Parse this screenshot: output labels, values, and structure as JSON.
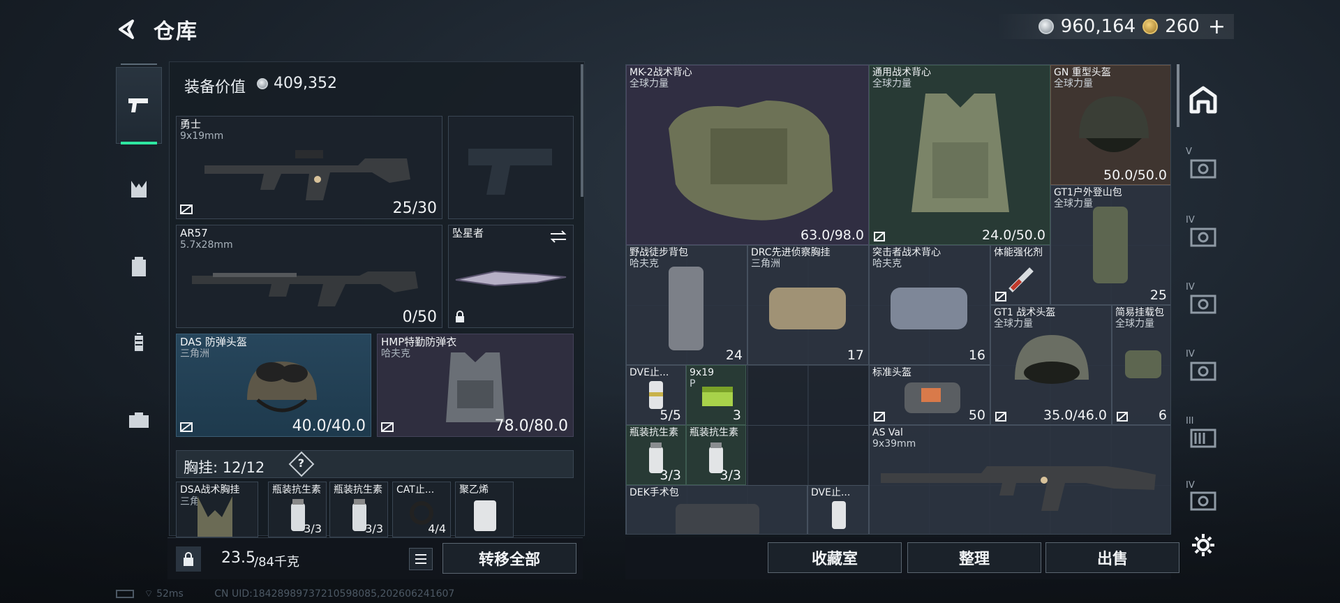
{
  "header": {
    "title": "仓库",
    "silver": "960,164",
    "gold": "260",
    "plus": "+"
  },
  "loadout": {
    "value_label": "装备价值",
    "value": "409,352",
    "slots": [
      {
        "name": "勇士",
        "sub": "9x19mm",
        "count": "25/30"
      },
      {
        "name": "AR57",
        "sub": "5.7x28mm",
        "count": "0/50"
      },
      {
        "name": "坠星者"
      },
      {
        "name": "DAS 防弹头盔",
        "sub": "三角洲",
        "count": "40.0/40.0"
      },
      {
        "name": "HMP特勤防弹衣",
        "sub": "哈夫克",
        "count": "78.0/80.0"
      }
    ],
    "chest_label": "胸挂:",
    "chest_count": "12/12",
    "chest_help": "?",
    "chest_items": [
      {
        "name": "DSA战术胸挂",
        "sub": "三角"
      },
      {
        "name": "瓶装抗生素",
        "count": "3/3"
      },
      {
        "name": "瓶装抗生素",
        "count": "3/3"
      },
      {
        "name": "CAT止...",
        "count": "4/4"
      },
      {
        "name": "聚乙烯"
      }
    ],
    "weight": "23.5",
    "weight_max": "/84千克",
    "transfer_all": "转移全部"
  },
  "stash": {
    "items": [
      {
        "name": "MK-2战术背心",
        "sub": "全球力量",
        "count": "63.0/98.0"
      },
      {
        "name": "通用战术背心",
        "sub": "全球力量",
        "count": "24.0/50.0"
      },
      {
        "name": "GN 重型头盔",
        "sub": "全球力量",
        "count": "50.0/50.0"
      },
      {
        "name": "GT1户外登山包",
        "sub": "全球力量",
        "count": "25"
      },
      {
        "name": "野战徒步背包",
        "sub": "哈夫克",
        "count": "24"
      },
      {
        "name": "DRC先进侦察胸挂",
        "sub": "三角洲",
        "count": "17"
      },
      {
        "name": "突击者战术背心",
        "sub": "哈夫克",
        "count": "16"
      },
      {
        "name": "体能强化剂"
      },
      {
        "name": "GT1 战术头盔",
        "sub": "全球力量",
        "count": "35.0/46.0"
      },
      {
        "name": "简易挂载包",
        "sub": "全球力量",
        "count": "6"
      },
      {
        "name": "DVE止...",
        "count": "5/5"
      },
      {
        "name": "9x19",
        "sub": "P",
        "count": "3"
      },
      {
        "name": "标准头盔",
        "count": "50"
      },
      {
        "name": "瓶装抗生素",
        "count": "3/3"
      },
      {
        "name": "瓶装抗生素",
        "count": "3/3"
      },
      {
        "name": "AS Val",
        "sub": "9x39mm"
      },
      {
        "name": "DEK手术包"
      },
      {
        "name": "DVE止..."
      }
    ],
    "buttons": {
      "collection": "收藏室",
      "sort": "整理",
      "sell": "出售"
    }
  },
  "right_tabs": [
    "V",
    "IV",
    "IV",
    "IV",
    "III",
    "IV"
  ],
  "status": {
    "ping": "52ms",
    "uid": "CN UID:18428989737210598085,202606241607"
  },
  "colors": {
    "accent": "#2ee6a0"
  }
}
